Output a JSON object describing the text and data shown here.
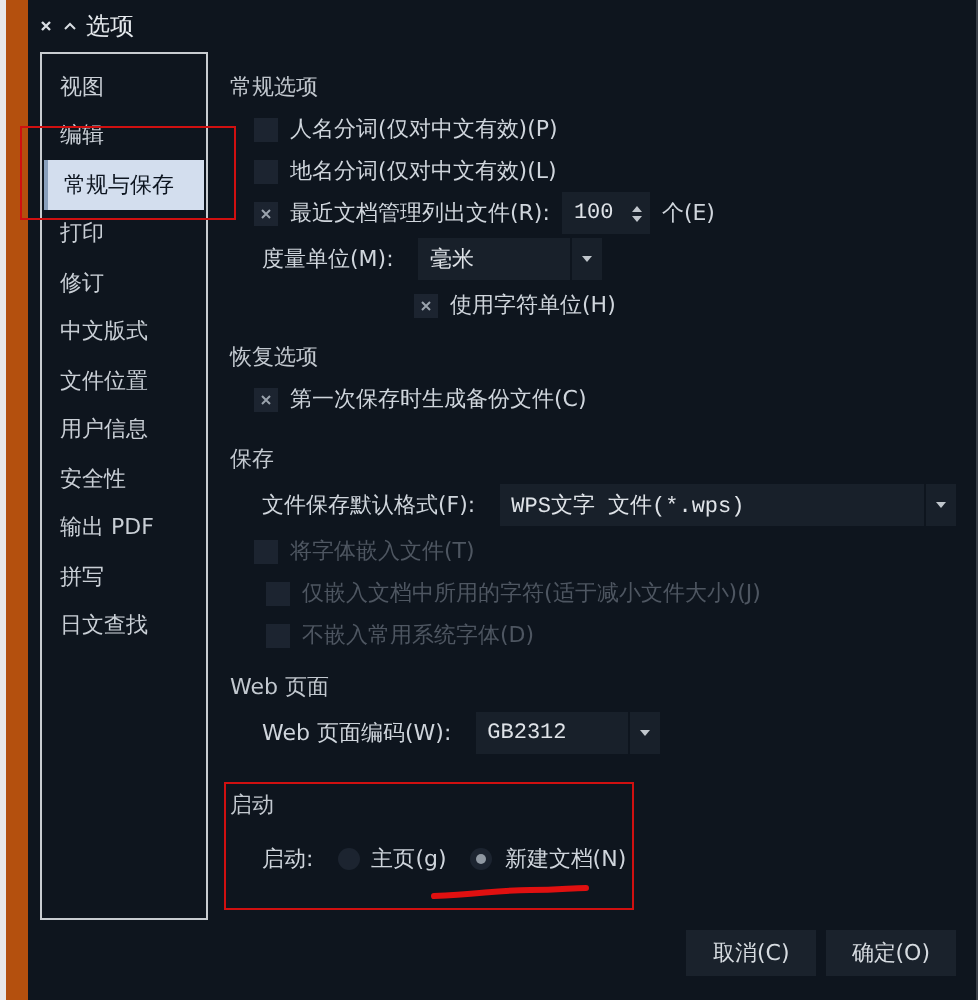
{
  "window": {
    "title": "选项"
  },
  "sidebar": {
    "items": [
      {
        "label": "视图",
        "selected": false
      },
      {
        "label": "编辑",
        "selected": false
      },
      {
        "label": "常规与保存",
        "selected": true
      },
      {
        "label": "打印",
        "selected": false
      },
      {
        "label": "修订",
        "selected": false
      },
      {
        "label": "中文版式",
        "selected": false
      },
      {
        "label": "文件位置",
        "selected": false
      },
      {
        "label": "用户信息",
        "selected": false
      },
      {
        "label": "安全性",
        "selected": false
      },
      {
        "label": "输出 PDF",
        "selected": false
      },
      {
        "label": "拼写",
        "selected": false
      },
      {
        "label": "日文查找",
        "selected": false
      }
    ]
  },
  "sections": [
    {
      "heading": "常规选项",
      "rows": [
        {
          "kind": "checkbox",
          "label": "人名分词(仅对中文有效)(P)",
          "checked": false,
          "disabled": false
        },
        {
          "kind": "checkbox",
          "label": "地名分词(仅对中文有效)(L)",
          "checked": false,
          "disabled": false
        },
        {
          "kind": "spin",
          "label": "最近文档管理列出文件(R):",
          "checked": true,
          "disabled": false,
          "value": "100",
          "suffix": "个(E)"
        },
        {
          "kind": "select",
          "label": "度量单位(M):",
          "value": "毫米",
          "children": [
            {
              "kind": "checkbox",
              "label": "使用字符单位(H)",
              "checked": true,
              "disabled": false
            }
          ]
        }
      ]
    },
    {
      "heading": "恢复选项",
      "rows": [
        {
          "kind": "checkbox",
          "label": "第一次保存时生成备份文件(C)",
          "checked": true,
          "disabled": false
        }
      ]
    },
    {
      "heading": "保存",
      "rows": [
        {
          "kind": "select",
          "label": "文件保存默认格式(F):",
          "value": "WPS文字 文件(*.wps)",
          "wide": true
        },
        {
          "kind": "checkbox",
          "label": "将字体嵌入文件(T)",
          "checked": false,
          "disabled": true,
          "children": [
            {
              "kind": "checkbox",
              "label": "仅嵌入文档中所用的字符(适于减小文件大小)(J)",
              "checked": false,
              "disabled": true
            },
            {
              "kind": "checkbox",
              "label": "不嵌入常用系统字体(D)",
              "checked": false,
              "disabled": true
            }
          ]
        }
      ]
    },
    {
      "heading": "Web 页面",
      "rows": [
        {
          "kind": "select",
          "label": "Web 页面编码(W):",
          "value": "GB2312"
        }
      ]
    },
    {
      "heading": "启动",
      "rows": [
        {
          "kind": "radio",
          "label": "启动:",
          "options": [
            {
              "label": "主页(g)",
              "selected": false
            },
            {
              "label": "新建文档(N)",
              "selected": true
            }
          ]
        }
      ]
    }
  ],
  "buttons": [
    "取消(C)",
    "确定(O)"
  ]
}
